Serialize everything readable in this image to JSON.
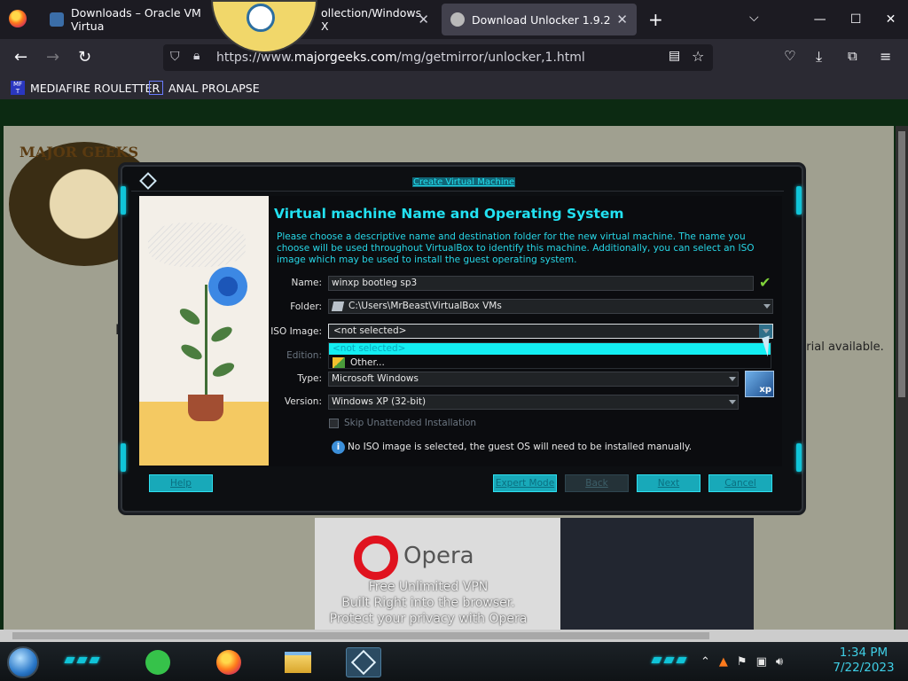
{
  "browser": {
    "tabs": [
      {
        "title": "Downloads – Oracle VM Virtua",
        "icon": "virtualbox-icon",
        "active": false
      },
      {
        "title": "ollection/Windows X",
        "icon": "page-icon",
        "active": false
      },
      {
        "title": "Download Unlocker 1.9.2",
        "icon": "majorgeeks-icon",
        "active": true
      }
    ],
    "address": {
      "prefix": "https://www.",
      "domain": "majorgeeks.com",
      "path": "/mg/getmirror/unlocker,1.html"
    },
    "bookmarks": [
      {
        "label": "MEDIAFIRE ROULETTER",
        "icon": "mediafire-icon"
      },
      {
        "label": "ANAL PROLAPSE",
        "icon": "bookmark-icon"
      }
    ]
  },
  "page": {
    "site_logo": "MAJOR GEEKS",
    "left_fragment_letter": "D",
    "right_fragment": "utorial available.",
    "ad": {
      "brand": "Opera",
      "line1": "Free Unlimited VPN",
      "line2": "Built Right into the browser.",
      "line3": "Protect your privacy with Opera"
    }
  },
  "dialog": {
    "window_title": "Create Virtual Machine",
    "heading": "Virtual machine Name and Operating System",
    "description": "Please choose a descriptive name and destination folder for the new virtual machine. The name you choose will be used throughout VirtualBox to identify this machine. Additionally, you can select an ISO image which may be used to install the guest operating system.",
    "fields": {
      "name_label": "Name:",
      "name_value": "winxp bootleg sp3",
      "folder_label": "Folder:",
      "folder_value": "C:\\Users\\MrBeast\\VirtualBox VMs",
      "iso_label": "ISO Image:",
      "iso_value": "<not selected>",
      "edition_label": "Edition:",
      "type_label": "Type:",
      "type_value": "Microsoft Windows",
      "version_label": "Version:",
      "version_value": "Windows XP (32-bit)",
      "os_badge": "xp"
    },
    "iso_dropdown": {
      "options": [
        "<not selected>",
        "Other..."
      ],
      "highlighted_index": 0
    },
    "skip_unattended": {
      "label": "Skip Unattended Installation",
      "checked": false,
      "enabled": false
    },
    "info_message": "No ISO image is selected, the guest OS will need to be installed manually.",
    "buttons": {
      "help": "Help",
      "expert": "Expert Mode",
      "back": "Back",
      "next": "Next",
      "cancel": "Cancel"
    }
  },
  "taskbar": {
    "apps": [
      "notes-app",
      "firefox",
      "file-explorer",
      "virtualbox"
    ],
    "clock_time": "1:34 PM",
    "clock_date": "7/22/2023"
  },
  "colors": {
    "accent_cyan": "#22e2f2",
    "dialog_bg": "#0b0c0f",
    "button_cyan": "#18a9b9",
    "valid_check": "#7fd23a"
  }
}
